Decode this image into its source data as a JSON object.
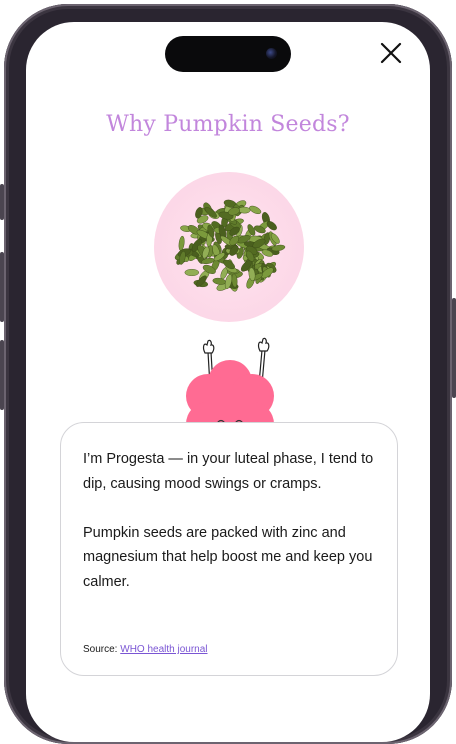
{
  "header": {
    "title": "Why Pumpkin Seeds?"
  },
  "close": {
    "icon": "close-icon"
  },
  "illustration": {
    "food": "pumpkin-seeds-image",
    "mascot": "progesta-mascot"
  },
  "card": {
    "paragraphs": [
      "I’m Progesta — in your luteal phase, I tend to dip, causing mood swings or cramps.",
      "Pumpkin seeds are packed with zinc and magnesium that help boost me and keep you calmer."
    ],
    "source_label": "Source:",
    "source_link": "WHO health journal"
  },
  "colors": {
    "title": "#c286dc",
    "mascot": "#ff6b93",
    "seed_bg": "#fbd8e8",
    "link": "#7a55d4"
  }
}
